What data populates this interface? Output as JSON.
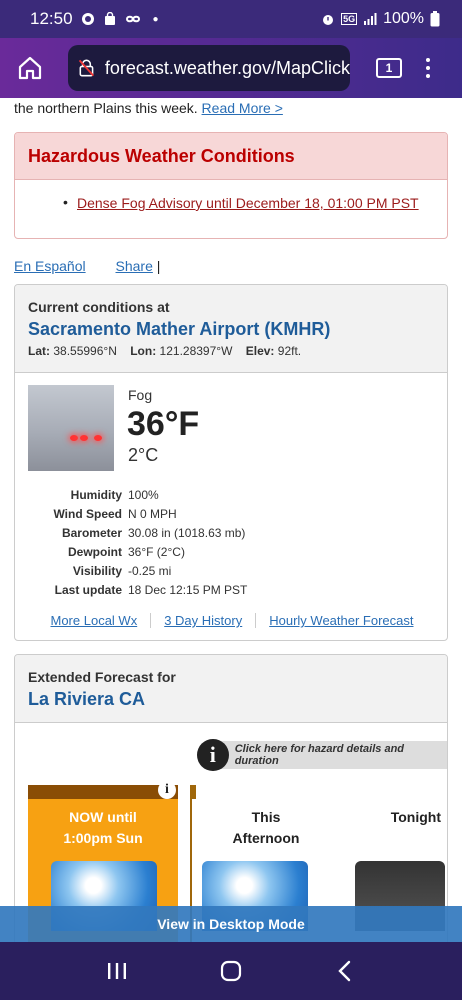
{
  "status_bar": {
    "time": "12:50",
    "battery": "100%",
    "network": "5G"
  },
  "browser": {
    "url": "forecast.weather.gov/MapClick",
    "tab_count": "1"
  },
  "intro": {
    "text": "the northern Plains this week.",
    "read_more": "Read More >"
  },
  "hazard": {
    "title": "Hazardous Weather Conditions",
    "items": [
      "Dense Fog Advisory until December 18, 01:00 PM PST"
    ]
  },
  "links": {
    "espanol": "En Español",
    "share": "Share",
    "share_sep": "|"
  },
  "current_conditions": {
    "label": "Current conditions at",
    "station": "Sacramento Mather Airport (KMHR)",
    "lat_label": "Lat:",
    "lat": "38.55996°N",
    "lon_label": "Lon:",
    "lon": "121.28397°W",
    "elev_label": "Elev:",
    "elev": "92ft.",
    "condition": "Fog",
    "temp_f": "36°F",
    "temp_c": "2°C",
    "details": [
      {
        "key": "Humidity",
        "value": "100%"
      },
      {
        "key": "Wind Speed",
        "value": "N 0 MPH"
      },
      {
        "key": "Barometer",
        "value": "30.08 in (1018.63 mb)"
      },
      {
        "key": "Dewpoint",
        "value": "36°F (2°C)"
      },
      {
        "key": "Visibility",
        "value": "-0.25 mi"
      },
      {
        "key": "Last update",
        "value": "18 Dec 12:15 PM PST"
      }
    ],
    "more_local": "More Local Wx",
    "history": "3 Day History",
    "hourly": "Hourly Weather Forecast"
  },
  "extended": {
    "label": "Extended Forecast for",
    "place": "La Riviera CA",
    "hazard_link": "Click here for hazard details and duration",
    "periods": [
      {
        "name_line1": "NOW until",
        "name_line2": "1:00pm Sun"
      },
      {
        "name_line1": "This",
        "name_line2": "Afternoon"
      },
      {
        "name_line1": "Tonight",
        "name_line2": ""
      }
    ]
  },
  "desktop_mode": "View in Desktop Mode",
  "colors": {
    "status_bg": "#3b2a7a",
    "link": "#2a6eb5",
    "hazard_red": "#b00000",
    "station_blue": "#1f5c99",
    "now_tile": "#f7a112"
  }
}
